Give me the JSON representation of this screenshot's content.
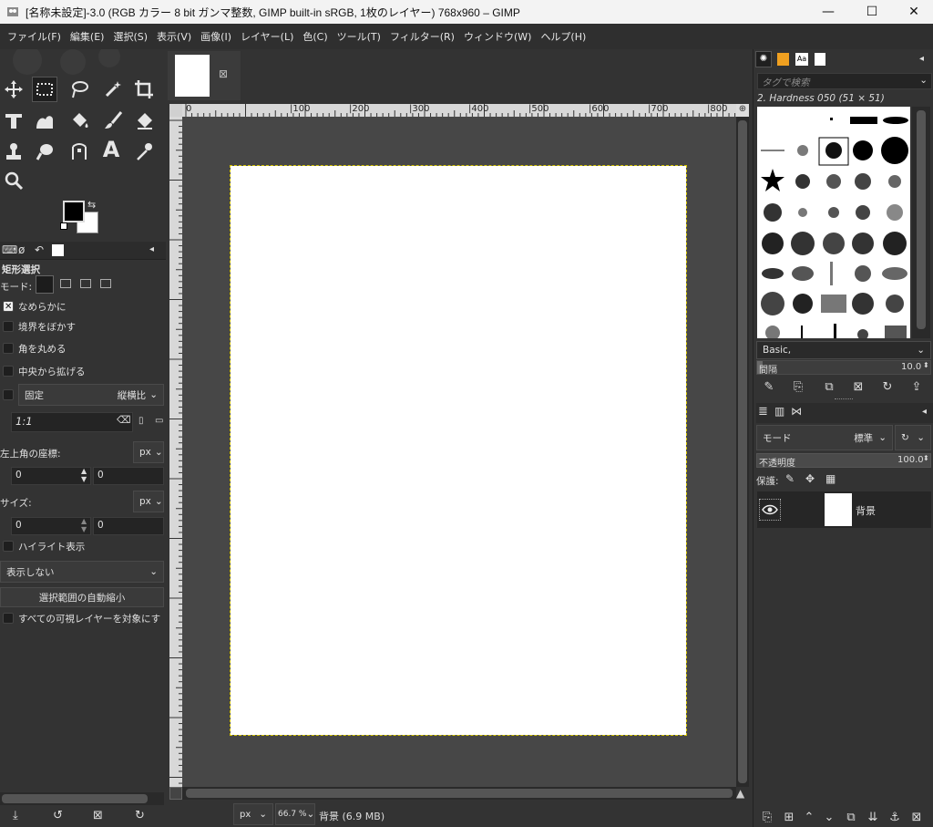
{
  "window": {
    "title": "[名称未設定]-3.0 (RGB カラー 8 bit ガンマ整数, GIMP built-in sRGB, 1枚のレイヤー) 768x960 – GIMP",
    "minimize": "—",
    "maximize": "☐",
    "close": "✕"
  },
  "menu": [
    "ファイル(F)",
    "編集(E)",
    "選択(S)",
    "表示(V)",
    "画像(I)",
    "レイヤー(L)",
    "色(C)",
    "ツール(T)",
    "フィルター(R)",
    "ウィンドウ(W)",
    "ヘルプ(H)"
  ],
  "tool_options": {
    "title": "矩形選択",
    "mode_label": "モード:",
    "antialias": "なめらかに",
    "feather": "境界をぼかす",
    "rounded": "角を丸める",
    "expand_center": "中央から拡げる",
    "fixed": "固定",
    "fixed_option": "縦横比",
    "ratio": "1:1",
    "position_label": "左上角の座標:",
    "unit_px": "px",
    "pos_x": "0",
    "pos_y": "0",
    "size_label": "サイズ:",
    "size_w": "0",
    "size_h": "0",
    "highlight": "ハイライト表示",
    "guides": "表示しない",
    "autoshrink": "選択範囲の自動縮小",
    "all_layers": "すべての可視レイヤーを対象にす"
  },
  "tools_text": {
    "text_tool_glyph": "A"
  },
  "ruler_labels": [
    "0",
    "|100",
    "|200",
    "|300",
    "|400",
    "|500",
    "|600",
    "|700",
    "|800"
  ],
  "status": {
    "unit": "px",
    "zoom": "66.7 %",
    "info": "背景 (6.9 MB)"
  },
  "brushes": {
    "filter_placeholder": "タグで検索",
    "current": "2. Hardness 050 (51 × 51)",
    "preset": "Basic,",
    "spacing_label": "間隔",
    "spacing_value": "10.0"
  },
  "layers": {
    "mode_label": "モード",
    "mode_value": "標準",
    "opacity_label": "不透明度",
    "opacity_value": "100.0",
    "lock_label": "保護:",
    "layer_name": "背景"
  },
  "colors": {
    "accent_dash": "#d4c300",
    "fg": "#000000",
    "bg": "#ffffff"
  }
}
